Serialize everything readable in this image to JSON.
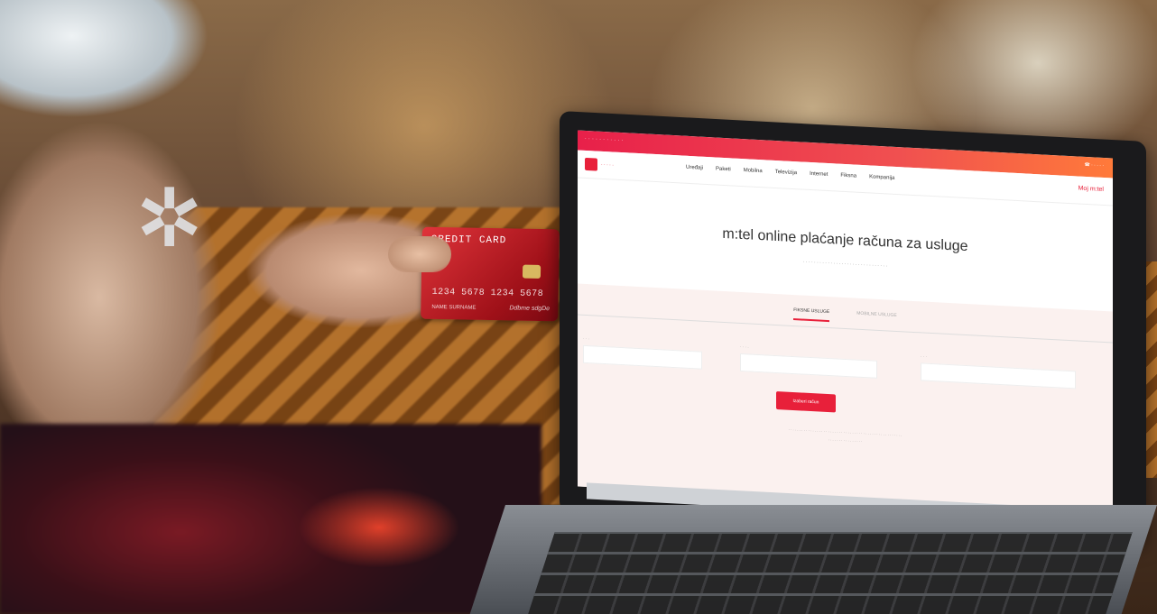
{
  "card": {
    "title": "CREDIT CARD",
    "number": "1234 5678 1234 5678",
    "holder": "NAME SURNAME",
    "signature": "Ddbme sdgDe"
  },
  "site": {
    "nav_items": [
      "Uređaji",
      "Paketi",
      "Mobilna",
      "Televizija",
      "Internet",
      "Fiksna",
      "Kompanija"
    ],
    "myt_label": "Moj m:tel",
    "title": "m:tel online plaćanje računa za usluge",
    "tabs": [
      "FIKSNE USLUGE",
      "MOBILNE USLUGE"
    ],
    "pay_button": "Izaberi račun"
  },
  "colors": {
    "brand": "#e8203a",
    "card_red": "#c41a22"
  }
}
